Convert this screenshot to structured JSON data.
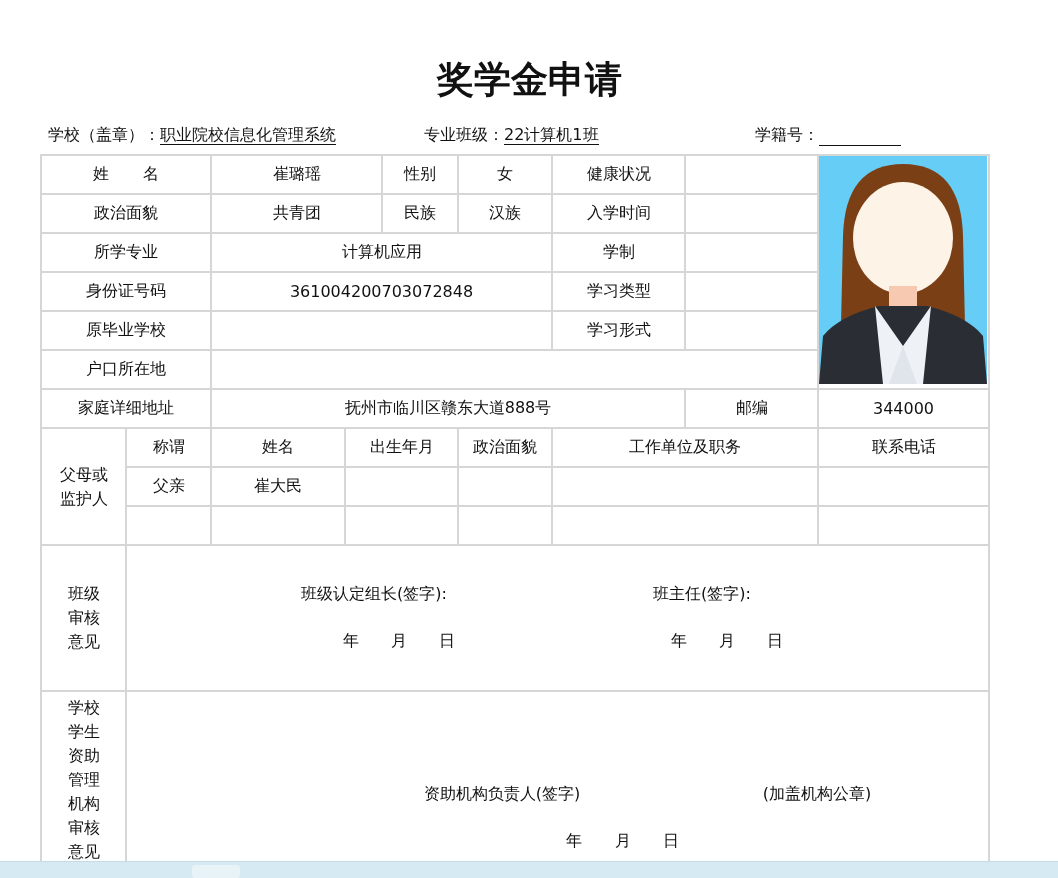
{
  "title": "奖学金申请",
  "info": [
    {
      "label": "学校（盖章）：",
      "value": "职业院校信息化管理系统"
    },
    {
      "label": "专业班级：",
      "value": "22计算机1班"
    },
    {
      "label": "学籍号："
    }
  ],
  "basic_rows": [
    [
      {
        "label": "姓 名",
        "value": "崔璐瑶"
      },
      {
        "label": "性别",
        "value": "女"
      },
      {
        "label": "健康状况"
      }
    ],
    [
      {
        "label": "政治面貌",
        "value": "共青团"
      },
      {
        "label": "民族",
        "value": "汉族"
      },
      {
        "label": "入学时间"
      }
    ],
    [
      {
        "label": "所学专业",
        "value": "计算机应用"
      },
      {
        "label": "学制"
      }
    ],
    [
      {
        "label": "身份证号码",
        "value": "361004200703072848"
      },
      {
        "label": "学习类型"
      }
    ],
    [
      {
        "label": "原毕业学校"
      },
      {
        "label": "学习形式"
      }
    ],
    [
      {
        "label": "户口所在地"
      }
    ],
    [
      {
        "label": "家庭详细地址",
        "value": "抚州市临川区赣东大道888号"
      },
      {
        "label": "邮编",
        "value": "344000"
      }
    ]
  ],
  "photo": {
    "kind": "picture"
  },
  "guardians": {
    "label": "父母或监护人",
    "columns": [
      "称谓",
      "姓名",
      "出生年月",
      "政治面貌",
      "工作单位及职务",
      "联系电话"
    ],
    "rows": [
      [
        "父亲",
        "崔大民"
      ]
    ]
  },
  "reviews": [
    {
      "label": "班级审核意见",
      "signatures": [
        {
          "text": "班级认定组长(签字):",
          "date": "年 月 日"
        },
        {
          "text": "班主任(签字):",
          "date": "年 月 日"
        }
      ]
    },
    {
      "label": "学校学生资助管理机构审核意见",
      "signatures": [
        {
          "text": "资助机构负责人(签字)"
        },
        {
          "text": "(加盖机构公章)"
        }
      ],
      "date": "年 月 日"
    }
  ]
}
